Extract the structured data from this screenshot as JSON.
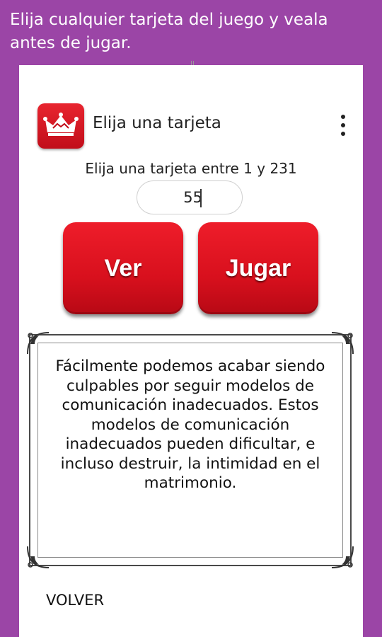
{
  "promo_text": "Elija cualquier tarjeta del juego y veala antes de jugar.",
  "app": {
    "title": "Elija una tarjeta",
    "icon": "crown-icon",
    "menu_icon": "more-vert-icon"
  },
  "picker": {
    "prompt": "Elija una tarjeta entre 1 y 231",
    "value": "55"
  },
  "buttons": {
    "ver": "Ver",
    "jugar": "Jugar"
  },
  "card": {
    "text": "Fácilmente podemos acabar siendo culpables por seguir modelos de comunicación inadecuados. Estos modelos de comunicación inadecuados pueden dificultar, e incluso destruir, la intimidad en el matrimonio."
  },
  "footer": {
    "back": "VOLVER"
  },
  "colors": {
    "background": "#9b45a6",
    "button_red": "#e3141f"
  }
}
